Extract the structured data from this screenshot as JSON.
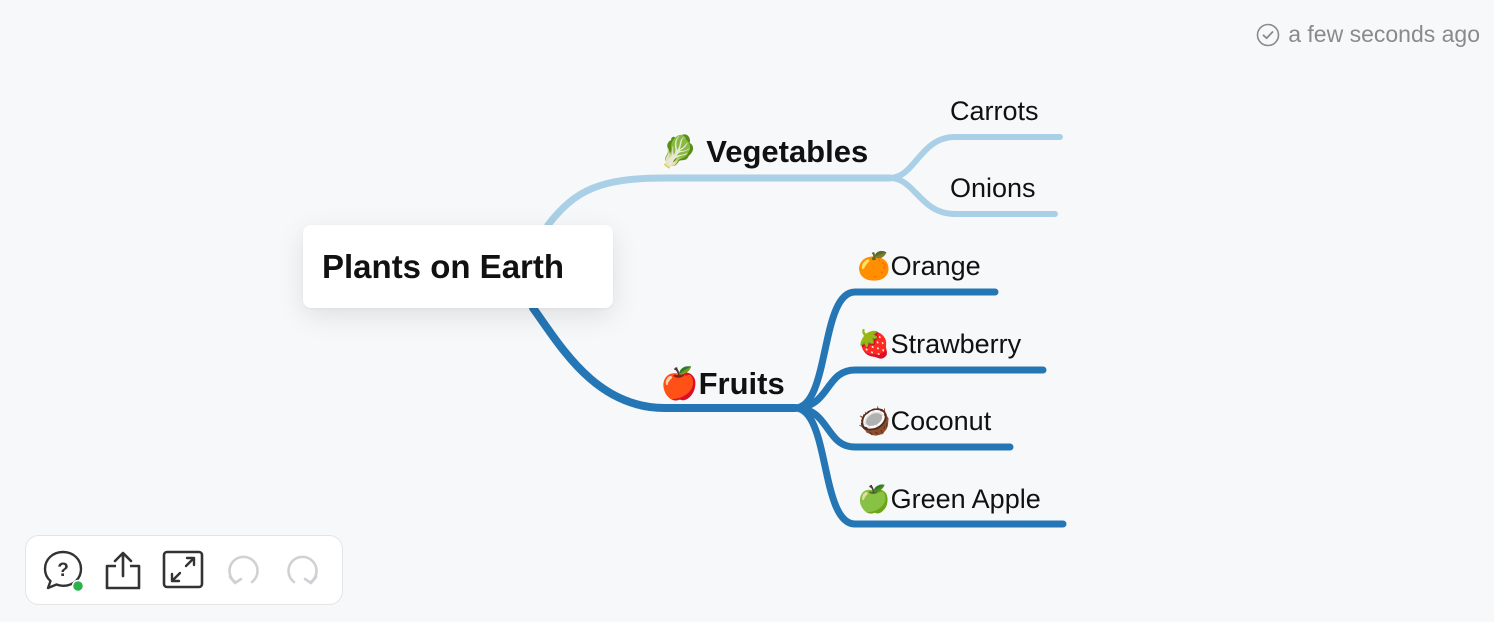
{
  "status": {
    "saved_text": "a few seconds ago",
    "icon": "check-circle-icon"
  },
  "mindmap": {
    "root": {
      "label": "Plants on Earth"
    },
    "branches": [
      {
        "id": "vegetables",
        "emoji": "🥬",
        "label": "Vegetables",
        "color": "#a9d0e6",
        "children": [
          {
            "emoji": "",
            "label": "Carrots"
          },
          {
            "emoji": "",
            "label": "Onions"
          }
        ]
      },
      {
        "id": "fruits",
        "emoji": "🍎",
        "label": "Fruits",
        "color": "#2576b5",
        "children": [
          {
            "emoji": "🍊",
            "label": "Orange"
          },
          {
            "emoji": "🍓",
            "label": "Strawberry"
          },
          {
            "emoji": "🥥",
            "label": "Coconut"
          },
          {
            "emoji": "🍏",
            "label": "Green Apple"
          }
        ]
      }
    ]
  },
  "toolbar": {
    "buttons": [
      {
        "icon": "help-chat-icon",
        "enabled": true,
        "badge_color": "#2bb24c"
      },
      {
        "icon": "share-icon",
        "enabled": true
      },
      {
        "icon": "fit-screen-icon",
        "enabled": true
      },
      {
        "icon": "undo-icon",
        "enabled": false
      },
      {
        "icon": "redo-icon",
        "enabled": false
      }
    ]
  }
}
